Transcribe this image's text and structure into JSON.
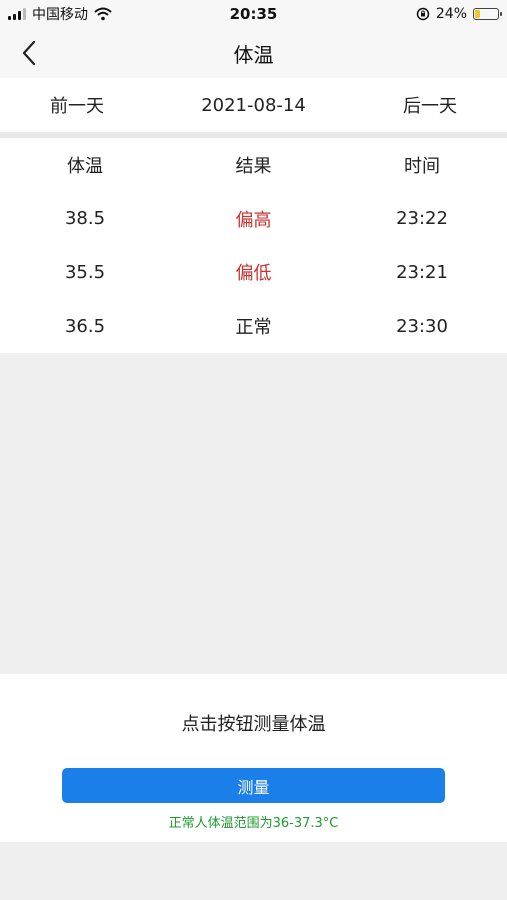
{
  "status_bar": {
    "carrier": "中国移动",
    "time": "20:35",
    "battery": "24%",
    "battery_level": 0.24
  },
  "nav": {
    "title": "体温"
  },
  "date_bar": {
    "prev_label": "前一天",
    "date": "2021-08-14",
    "next_label": "后一天"
  },
  "table": {
    "headers": [
      "体温",
      "结果",
      "时间"
    ],
    "rows": [
      {
        "temp": "38.5",
        "result": "偏高",
        "time": "23:22"
      },
      {
        "temp": "35.5",
        "result": "偏低",
        "time": "23:21"
      },
      {
        "temp": "36.5",
        "result": "正常",
        "time": "23:30"
      }
    ]
  },
  "measure": {
    "prompt": "点击按钮测量体温",
    "button_label": "测量",
    "hint": "正常人体温范围为36-37.3°C"
  },
  "colors": {
    "accent": "#1a7fe8",
    "abnormal": "#c8322f",
    "hint": "#1f9a2e"
  }
}
